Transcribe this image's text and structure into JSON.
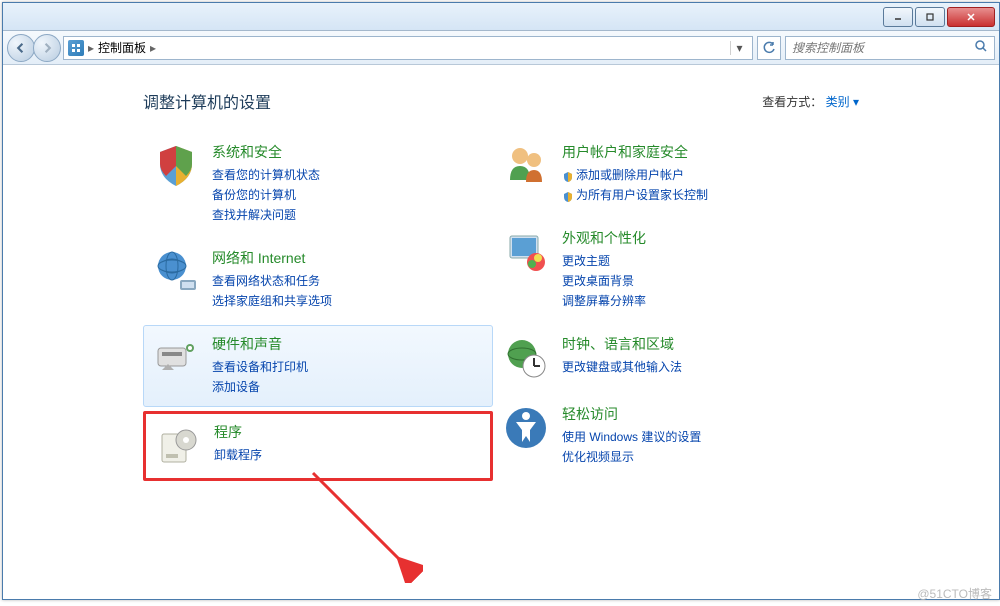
{
  "breadcrumb": {
    "root": "控制面板"
  },
  "search": {
    "placeholder": "搜索控制面板"
  },
  "header": {
    "title": "调整计算机的设置",
    "view_label": "查看方式：",
    "view_value": "类别"
  },
  "categories_left": [
    {
      "id": "system-security",
      "title": "系统和安全",
      "links": [
        "查看您的计算机状态",
        "备份您的计算机",
        "查找并解决问题"
      ]
    },
    {
      "id": "network-internet",
      "title": "网络和 Internet",
      "links": [
        "查看网络状态和任务",
        "选择家庭组和共享选项"
      ]
    },
    {
      "id": "hardware-sound",
      "title": "硬件和声音",
      "links": [
        "查看设备和打印机",
        "添加设备"
      ],
      "selected": true
    },
    {
      "id": "programs",
      "title": "程序",
      "links": [
        "卸载程序"
      ],
      "highlighted": true
    }
  ],
  "categories_right": [
    {
      "id": "user-accounts",
      "title": "用户帐户和家庭安全",
      "links": [
        {
          "text": "添加或删除用户帐户",
          "shield": true
        },
        {
          "text": "为所有用户设置家长控制",
          "shield": true
        }
      ]
    },
    {
      "id": "appearance",
      "title": "外观和个性化",
      "links": [
        "更改主题",
        "更改桌面背景",
        "调整屏幕分辨率"
      ]
    },
    {
      "id": "clock-region",
      "title": "时钟、语言和区域",
      "links": [
        "更改键盘或其他输入法"
      ]
    },
    {
      "id": "ease-access",
      "title": "轻松访问",
      "links": [
        "使用 Windows 建议的设置",
        "优化视频显示"
      ]
    }
  ],
  "watermark": "@51CTO博客"
}
